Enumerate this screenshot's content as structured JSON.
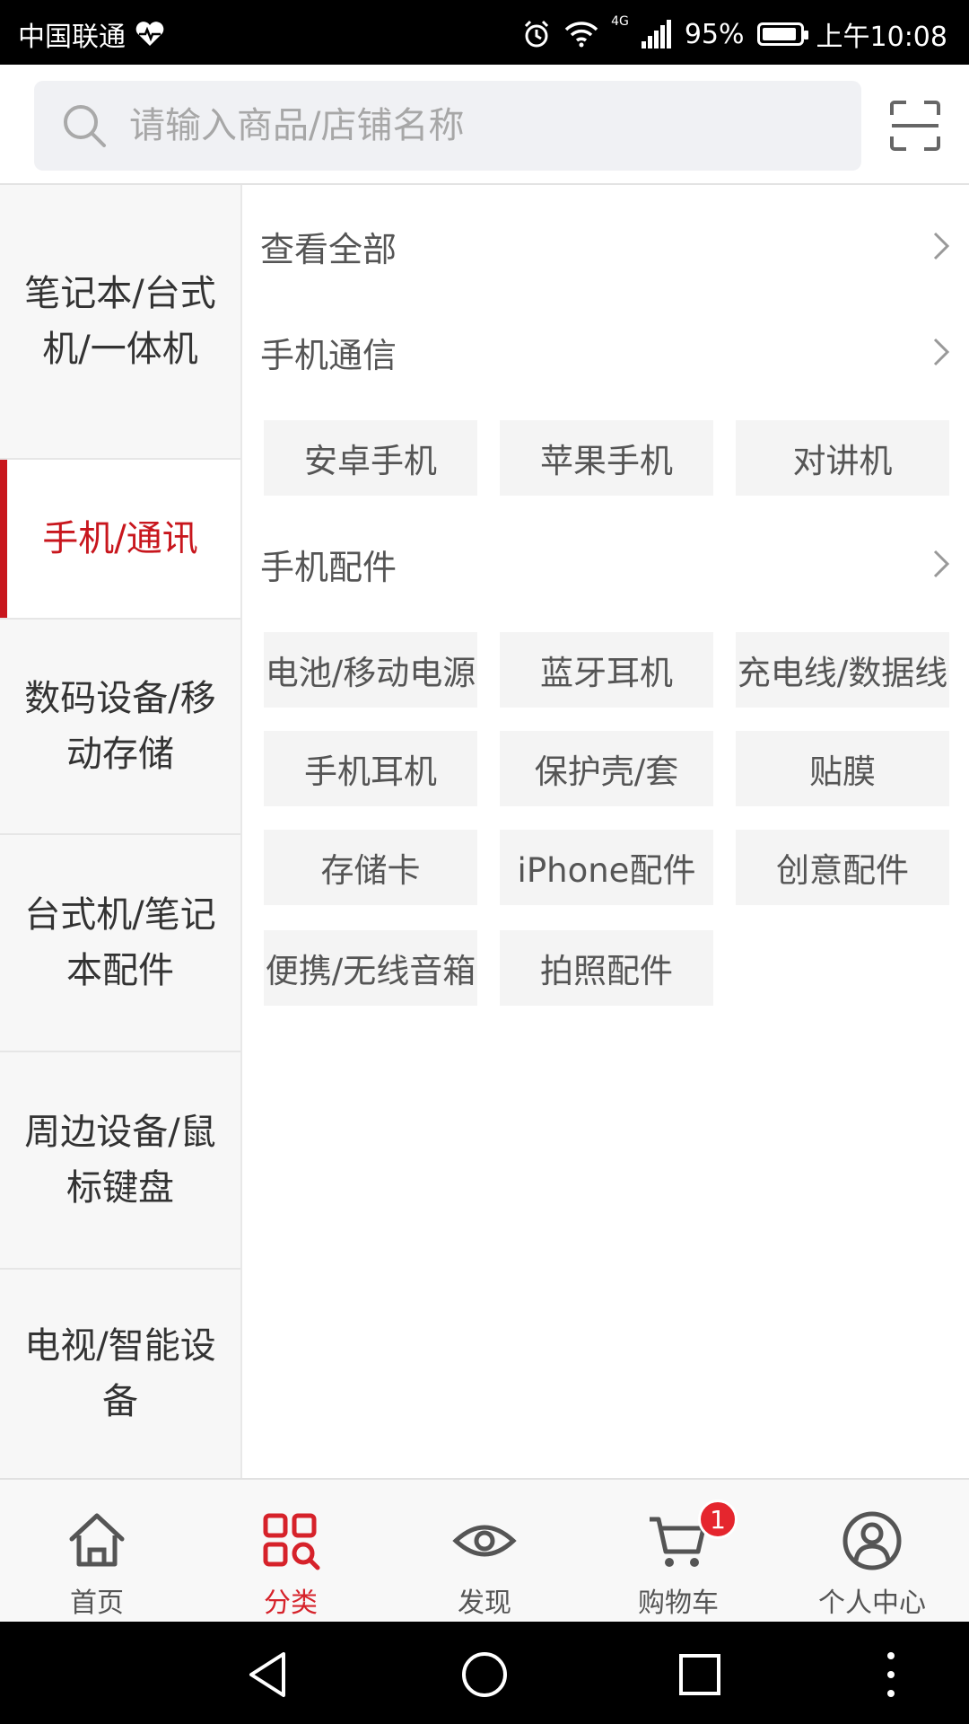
{
  "status_bar": {
    "carrier": "中国联通",
    "network": "4G",
    "battery": "95%",
    "time": "上午10:08"
  },
  "search": {
    "placeholder": "请输入商品/店铺名称"
  },
  "sidebar": {
    "items": [
      {
        "label": "笔记本/台式机/一体机",
        "active": false
      },
      {
        "label": "手机/通讯",
        "active": true
      },
      {
        "label": "数码设备/移动存储",
        "active": false
      },
      {
        "label": "台式机/笔记本配件",
        "active": false
      },
      {
        "label": "周边设备/鼠标键盘",
        "active": false
      },
      {
        "label": "电视/智能设备",
        "active": false
      }
    ]
  },
  "content": {
    "view_all": "查看全部",
    "sections": [
      {
        "title": "手机通信",
        "items": [
          "安卓手机",
          "苹果手机",
          "对讲机"
        ]
      },
      {
        "title": "手机配件",
        "items": [
          "电池/移动电源",
          "蓝牙耳机",
          "充电线/数据线",
          "手机耳机",
          "保护壳/套",
          "贴膜",
          "存储卡",
          "iPhone配件",
          "创意配件",
          "便携/无线音箱",
          "拍照配件"
        ]
      }
    ]
  },
  "tabbar": {
    "items": [
      {
        "label": "首页",
        "icon": "home-icon"
      },
      {
        "label": "分类",
        "icon": "category-icon",
        "active": true
      },
      {
        "label": "发现",
        "icon": "eye-icon"
      },
      {
        "label": "购物车",
        "icon": "cart-icon",
        "badge": "1"
      },
      {
        "label": "个人中心",
        "icon": "user-icon"
      }
    ]
  },
  "colors": {
    "accent": "#c8161d",
    "sidebar_bg": "#f7f7f7",
    "chip_bg": "#f4f4f4"
  }
}
